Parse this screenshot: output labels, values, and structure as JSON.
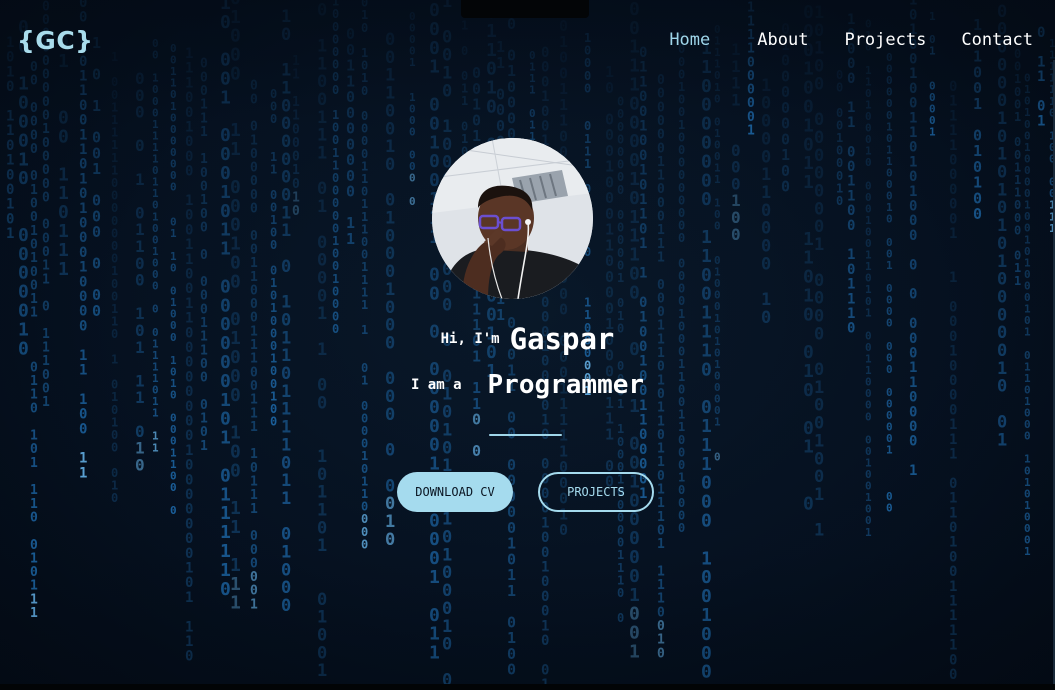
{
  "header": {
    "logo": "{GC}",
    "nav": [
      {
        "label": "Home",
        "active": true
      },
      {
        "label": "About",
        "active": false
      },
      {
        "label": "Projects",
        "active": false
      },
      {
        "label": "Contact",
        "active": false
      }
    ]
  },
  "hero": {
    "greeting": "Hi, I'm",
    "name": "Gaspar",
    "role_prefix": "I am a",
    "role": "Programmer",
    "buttons": {
      "download": "DOWNLOAD CV",
      "projects": "PROJECTS"
    }
  },
  "colors": {
    "accent": "#a5dbee",
    "background": "#061222",
    "rain": "#1f6fb3"
  },
  "icons": {
    "background": "matrix-rain",
    "avatar": "profile-photo"
  }
}
